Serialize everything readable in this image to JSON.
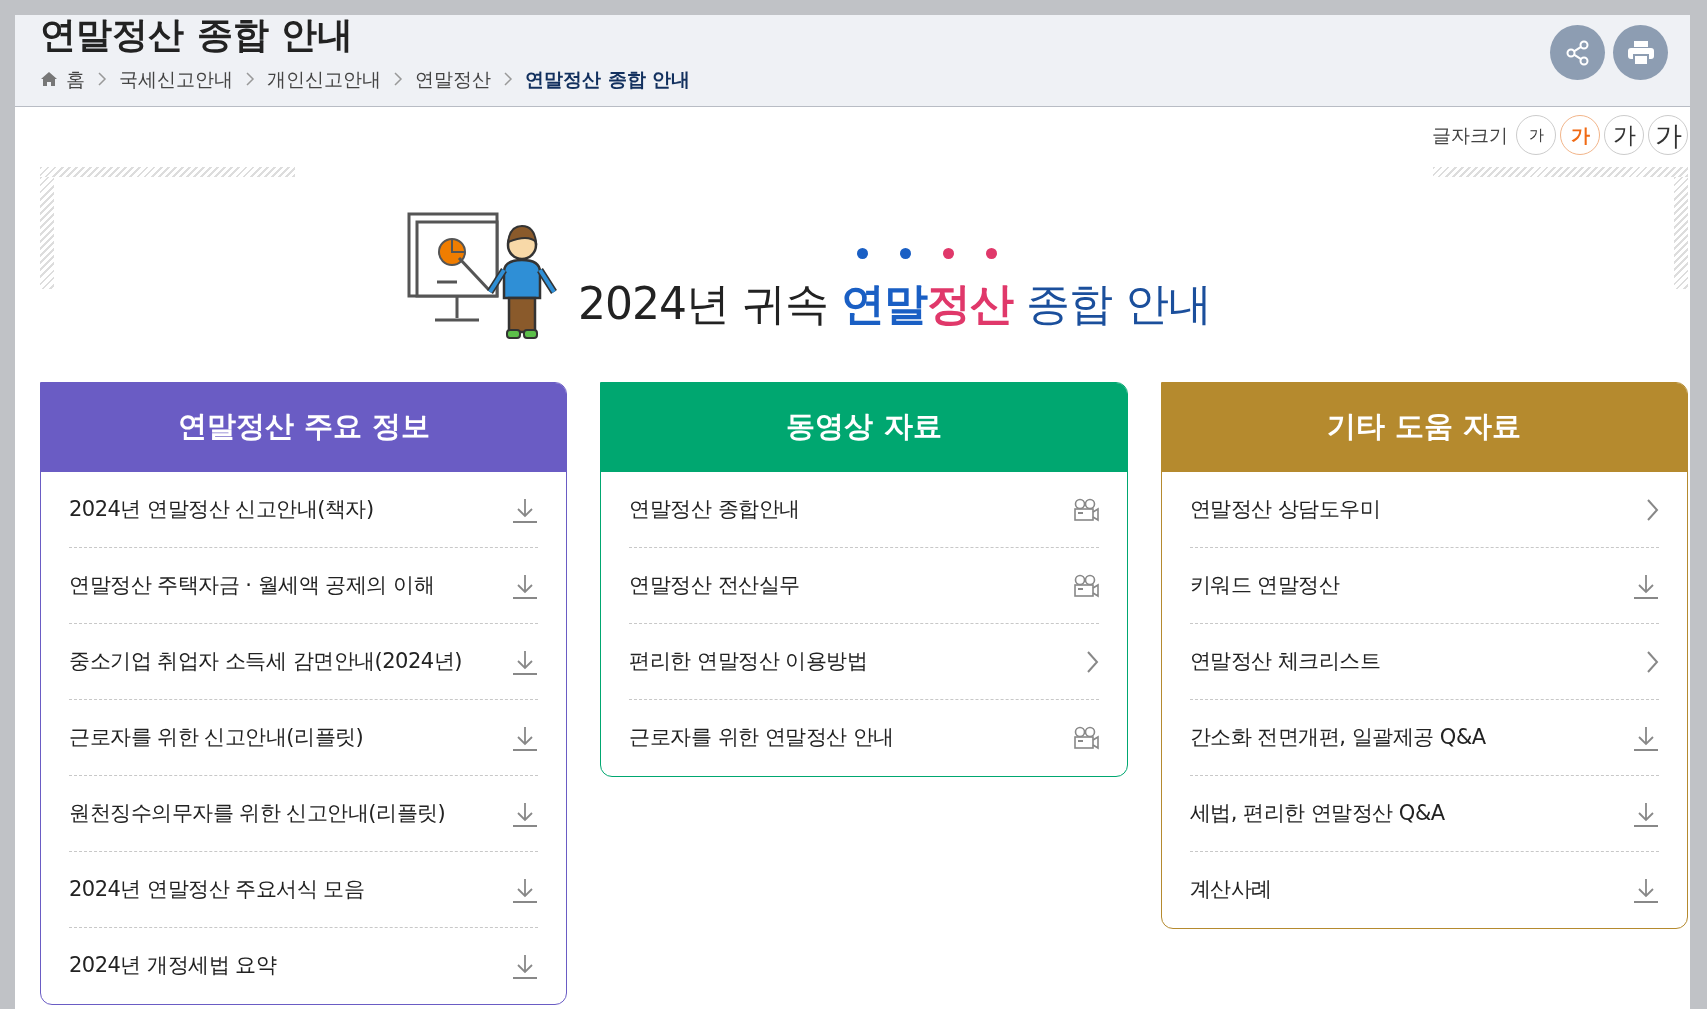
{
  "page_title": "연말정산 종합 안내",
  "breadcrumb": [
    {
      "label": "홈",
      "current": false
    },
    {
      "label": "국세신고안내",
      "current": false
    },
    {
      "label": "개인신고안내",
      "current": false
    },
    {
      "label": "연말정산",
      "current": false
    },
    {
      "label": "연말정산 종합 안내",
      "current": true
    }
  ],
  "font_size": {
    "label": "글자크기",
    "options": [
      {
        "label": "가",
        "selected": false
      },
      {
        "label": "가",
        "selected": true
      },
      {
        "label": "가",
        "selected": false
      },
      {
        "label": "가",
        "selected": false
      }
    ]
  },
  "banner": {
    "title_parts": [
      {
        "text": "2024년 귀속 ",
        "color": "#222222",
        "emphasis": false
      },
      {
        "text": "연말",
        "color": "#1a5fc4",
        "emphasis": true
      },
      {
        "text": "정산",
        "color": "#e0386a",
        "emphasis": true
      },
      {
        "text": " 종합 안내",
        "color": "#1b4f9c",
        "emphasis": false
      }
    ]
  },
  "sections": [
    {
      "title": "연말정산 주요 정보",
      "color": "#6a5cc4",
      "items": [
        {
          "label": "2024년 연말정산 신고안내(책자)",
          "kind": "download"
        },
        {
          "label": "연말정산 주택자금 · 월세액 공제의 이해",
          "kind": "download"
        },
        {
          "label": "중소기업 취업자 소득세 감면안내(2024년)",
          "kind": "download"
        },
        {
          "label": "근로자를 위한 신고안내(리플릿)",
          "kind": "download"
        },
        {
          "label": "원천징수의무자를 위한 신고안내(리플릿)",
          "kind": "download"
        },
        {
          "label": "2024년 연말정산 주요서식 모음",
          "kind": "download"
        },
        {
          "label": "2024년 개정세법 요약",
          "kind": "download"
        }
      ]
    },
    {
      "title": "동영상 자료",
      "color": "#00a770",
      "items": [
        {
          "label": "연말정산 종합안내",
          "kind": "video"
        },
        {
          "label": "연말정산 전산실무",
          "kind": "video"
        },
        {
          "label": "편리한 연말정산 이용방법",
          "kind": "link"
        },
        {
          "label": "근로자를 위한 연말정산 안내",
          "kind": "video"
        }
      ]
    },
    {
      "title": "기타 도움 자료",
      "color": "#b58a2e",
      "items": [
        {
          "label": "연말정산 상담도우미",
          "kind": "link"
        },
        {
          "label": "키워드 연말정산",
          "kind": "download"
        },
        {
          "label": "연말정산 체크리스트",
          "kind": "link"
        },
        {
          "label": "간소화 전면개편, 일괄제공 Q&A",
          "kind": "download"
        },
        {
          "label": "세법, 편리한 연말정산 Q&A",
          "kind": "download"
        },
        {
          "label": "계산사례",
          "kind": "download"
        }
      ]
    }
  ]
}
